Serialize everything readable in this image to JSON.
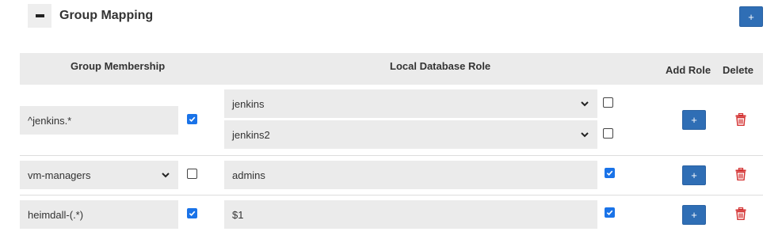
{
  "section": {
    "collapse_label": "−",
    "title": "Group Mapping",
    "add_label": "+"
  },
  "table": {
    "headers": {
      "group_membership": "Group Membership",
      "local_database_role": "Local Database Role",
      "add_role": "Add Role",
      "delete": "Delete"
    },
    "rows": [
      {
        "group": "^jenkins.*",
        "group_type": "text",
        "group_checked": true,
        "roles": [
          {
            "value": "jenkins",
            "type": "select",
            "checked": false
          },
          {
            "value": "jenkins2",
            "type": "select",
            "checked": false
          }
        ],
        "add_role_label": "+"
      },
      {
        "group": "vm-managers",
        "group_type": "select",
        "group_checked": false,
        "roles": [
          {
            "value": "admins",
            "type": "text",
            "checked": true
          }
        ],
        "add_role_label": "+"
      },
      {
        "group": "heimdall-(.*)",
        "group_type": "text",
        "group_checked": true,
        "roles": [
          {
            "value": "$1",
            "type": "text",
            "checked": true
          }
        ],
        "add_role_label": "+"
      }
    ]
  },
  "colors": {
    "accent_blue": "#2f6eb5",
    "checkbox_blue": "#1a73e8",
    "delete_red": "#d32f2f",
    "field_gray": "#ebebeb"
  }
}
